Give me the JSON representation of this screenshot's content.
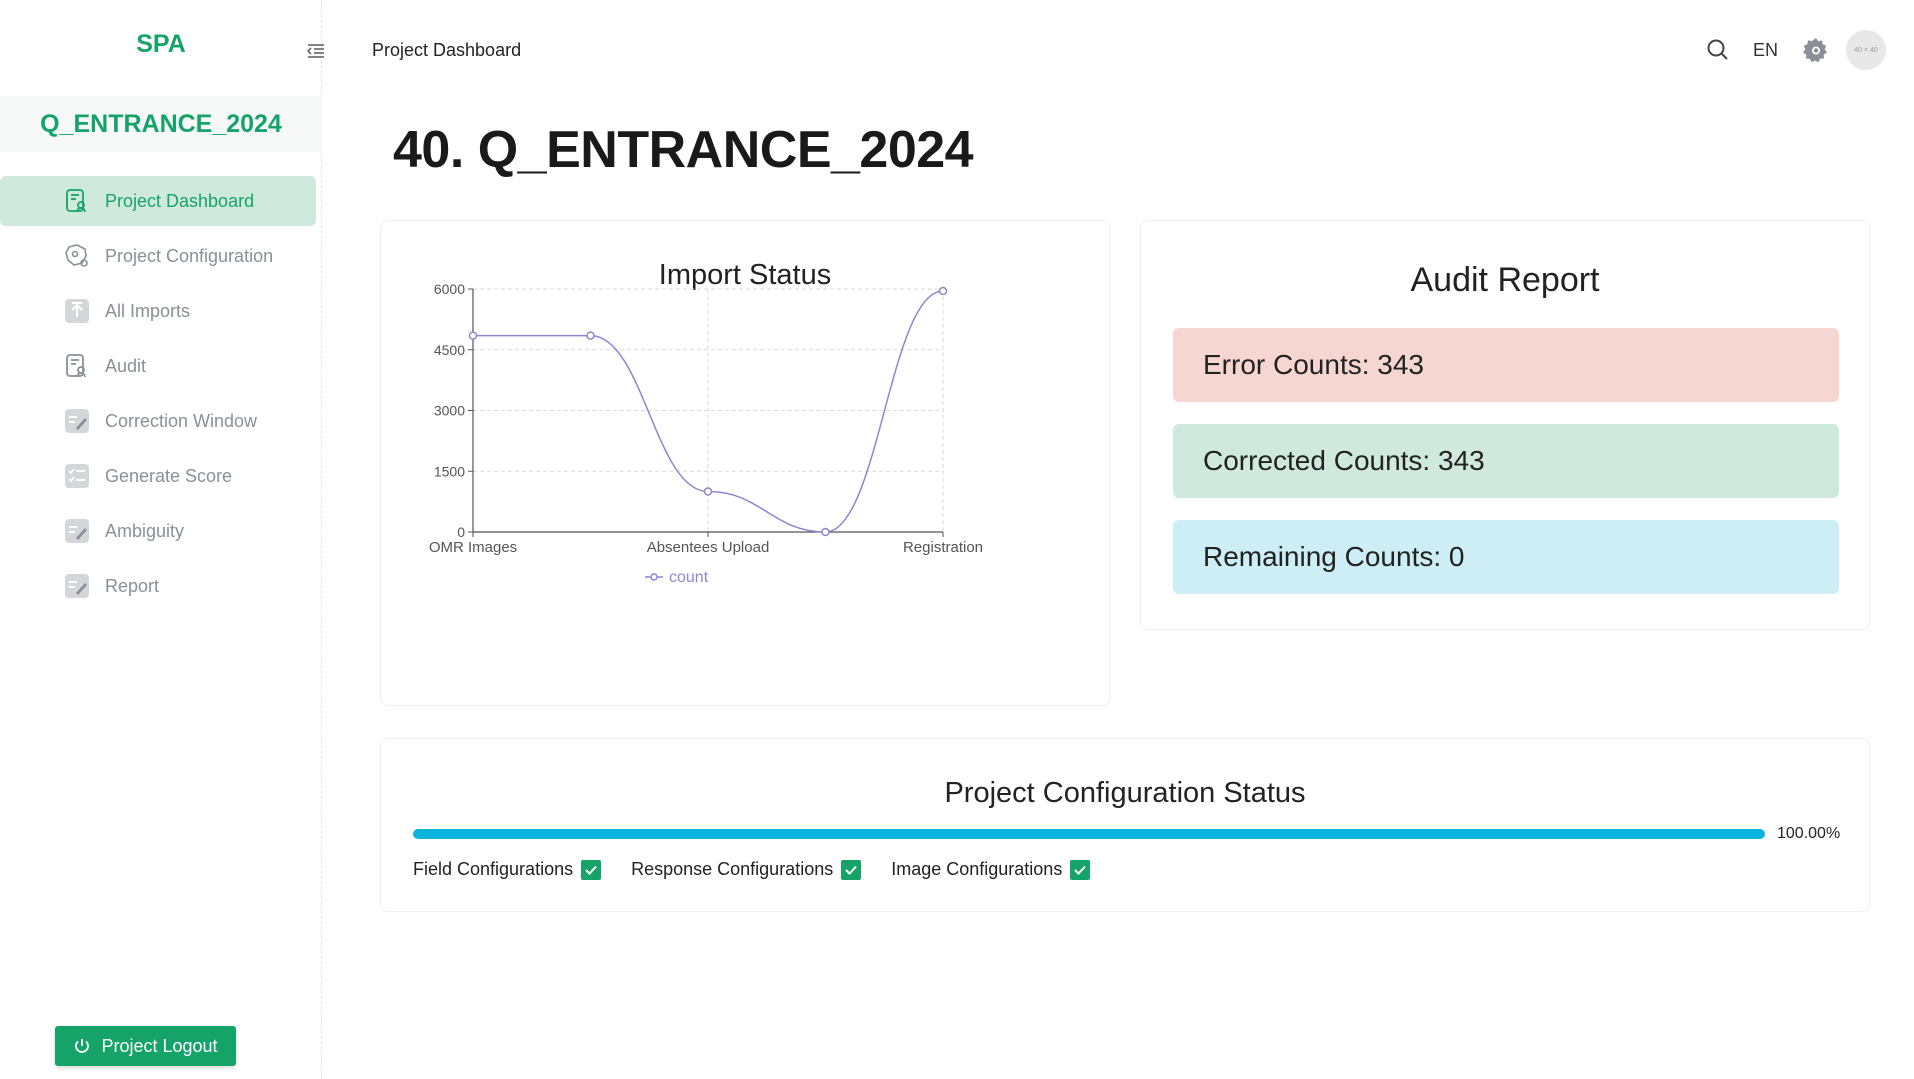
{
  "sidebar": {
    "brand": "SPA",
    "project_name": "Q_ENTRANCE_2024",
    "items": [
      {
        "label": "Project Dashboard",
        "icon": "dashboard-doc-icon",
        "active": true
      },
      {
        "label": "Project Configuration",
        "icon": "config-gear-icon",
        "active": false
      },
      {
        "label": "All Imports",
        "icon": "upload-icon",
        "active": false
      },
      {
        "label": "Audit",
        "icon": "audit-doc-icon",
        "active": false
      },
      {
        "label": "Correction Window",
        "icon": "edit-doc-icon",
        "active": false
      },
      {
        "label": "Generate Score",
        "icon": "checklist-icon",
        "active": false
      },
      {
        "label": "Ambiguity",
        "icon": "edit-doc-icon",
        "active": false
      },
      {
        "label": "Report",
        "icon": "edit-doc-icon",
        "active": false
      }
    ],
    "logout_label": "Project Logout"
  },
  "header": {
    "breadcrumb": "Project Dashboard",
    "language": "EN",
    "avatar_text": "40 × 40"
  },
  "page_title": "40. Q_ENTRANCE_2024",
  "import_status": {
    "title": "Import Status"
  },
  "chart_data": {
    "type": "line",
    "title": "Import Status",
    "categories": [
      "OMR Images",
      "Absentees Upload",
      "Registration"
    ],
    "x": [
      "",
      "",
      "",
      "",
      ""
    ],
    "points": [
      4850,
      4850,
      1000,
      0,
      5950
    ],
    "point_positions": [
      0,
      0.5,
      1,
      1.5,
      2
    ],
    "series": [
      {
        "name": "count",
        "values": [
          4850,
          4850,
          1000,
          0,
          5950
        ]
      }
    ],
    "yticks": [
      "0",
      "1500",
      "3000",
      "4500",
      "6000"
    ],
    "ylim": [
      0,
      6000
    ],
    "grid": true,
    "legend": "bottom",
    "color": "#8f86d2"
  },
  "audit_report": {
    "title": "Audit Report",
    "error": "Error Counts: 343",
    "corrected": "Corrected Counts: 343",
    "remaining": "Remaining Counts: 0"
  },
  "config_status": {
    "title": "Project Configuration Status",
    "progress": 1.0,
    "progress_label": "100.00%",
    "checks": [
      {
        "label": "Field Configurations",
        "checked": true
      },
      {
        "label": "Response Configurations",
        "checked": true
      },
      {
        "label": "Image Configurations",
        "checked": true
      }
    ]
  },
  "colors": {
    "accent": "#16a36a",
    "active_bg": "#cfe9dc",
    "error_bg": "#f6d6d1",
    "corrected_bg": "#cfe9dc",
    "remaining_bg": "#cdeef5",
    "progress": "#0ab4dc"
  }
}
